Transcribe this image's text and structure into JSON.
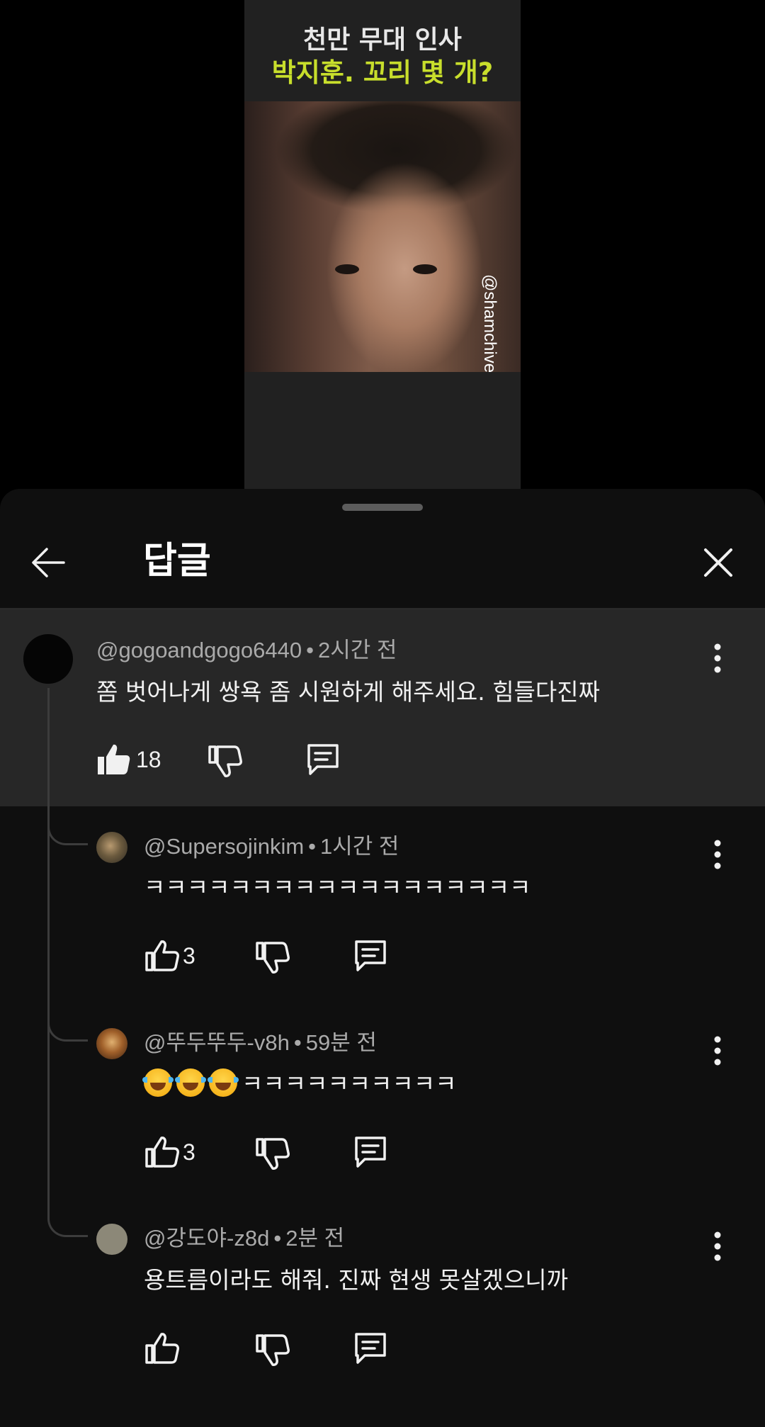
{
  "video": {
    "title_line1": "천만 무대 인사",
    "title_line2": "박지훈. 꼬리 몇 개?",
    "watermark": "@shamchive"
  },
  "header": {
    "title": "답글",
    "back_icon": "arrow-left-icon",
    "close_icon": "close-icon"
  },
  "comments": [
    {
      "author": "@gogoandgogo6440",
      "time": "2시간 전",
      "text": "쫌 벗어나게 쌍욕 좀 시원하게 해주세요. 힘들다진짜",
      "likes": "18",
      "liked": true,
      "highlighted": true
    },
    {
      "author": "@Supersojinkim",
      "time": "1시간 전",
      "text": "ㅋㅋㅋㅋㅋㅋㅋㅋㅋㅋㅋㅋㅋㅋㅋㅋㅋㅋ",
      "likes": "3",
      "liked": false
    },
    {
      "author": "@뚜두뚜두-v8h",
      "time": "59분 전",
      "emoji_count": 3,
      "text": "ㅋㅋㅋㅋㅋㅋㅋㅋㅋㅋ",
      "likes": "3",
      "liked": false
    },
    {
      "author": "@강도야-z8d",
      "time": "2분 전",
      "text": "용트름이라도 해줘. 진짜 현생 못살겠으니까",
      "likes": "",
      "liked": false
    }
  ],
  "separator": "•",
  "colors": {
    "sheet_bg": "#0f0f0f",
    "highlight_bg": "#272727",
    "title_accent": "#c8de2c",
    "meta_text": "#aaaaaa"
  }
}
